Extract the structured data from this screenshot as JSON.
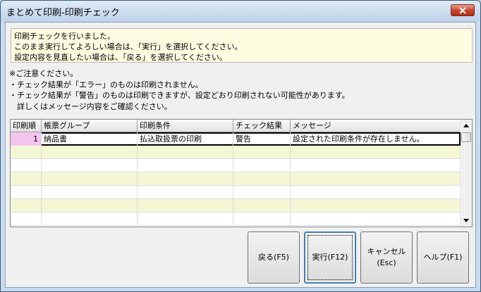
{
  "window": {
    "title": "まとめて印刷-印刷チェック"
  },
  "message": {
    "lines": [
      "印刷チェックを行いました。",
      "このまま実行してよろしい場合は、「実行」を選択してください。",
      "設定内容を見直したい場合は、「戻る」を選択してください。"
    ]
  },
  "notes": {
    "lines": [
      "※ご注意ください。",
      "・チェック結果が「エラー」のものは印刷されません。",
      "・チェック結果が「警告」のものは印刷できますが、設定どおり印刷されない可能性があります。",
      "　詳しくはメッセージ内容をご確認ください。"
    ]
  },
  "grid": {
    "columns": [
      "印刷順",
      "帳票グループ",
      "印刷条件",
      "チェック結果",
      "メッセージ"
    ],
    "rows": [
      [
        "1",
        "納品書",
        "払込取扱票の印刷",
        "警告",
        "設定された印刷条件が存在しません。"
      ],
      [
        "",
        "",
        "",
        "",
        ""
      ],
      [
        "",
        "",
        "",
        "",
        ""
      ],
      [
        "",
        "",
        "",
        "",
        ""
      ],
      [
        "",
        "",
        "",
        "",
        ""
      ],
      [
        "",
        "",
        "",
        "",
        ""
      ],
      [
        "",
        "",
        "",
        "",
        ""
      ]
    ]
  },
  "buttons": {
    "back": "戻る(F5)",
    "execute": "実行(F12)",
    "cancel_line1": "キャンセル",
    "cancel_line2": "(Esc)",
    "help": "ヘルプ(F1)"
  },
  "icons": {
    "close": "close-icon",
    "scroll_up": "scroll-up-arrow-icon",
    "scroll_down": "scroll-down-arrow-icon"
  },
  "colors": {
    "message_bg": "#fffde1",
    "alt_row": "#f4f7d4",
    "selected_cell": "#f4c4ee",
    "close_button": "#c9452f"
  }
}
